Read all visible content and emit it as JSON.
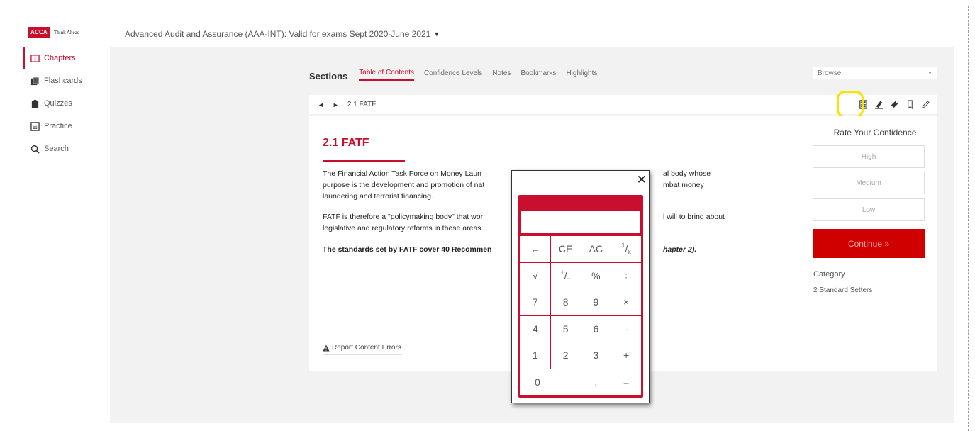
{
  "brand": {
    "logo_text": "ACCA",
    "tagline": "Think Ahead",
    "accent_color": "#c8102e"
  },
  "nav": {
    "items": [
      {
        "label": "Chapters",
        "icon": "book-icon",
        "active": true
      },
      {
        "label": "Flashcards",
        "icon": "flashcards-icon",
        "active": false
      },
      {
        "label": "Quizzes",
        "icon": "quiz-icon",
        "active": false
      },
      {
        "label": "Practice",
        "icon": "practice-icon",
        "active": false
      },
      {
        "label": "Search",
        "icon": "search-icon",
        "active": false
      }
    ]
  },
  "course": {
    "title": "Advanced Audit and Assurance (AAA-INT): Valid for exams Sept 2020-June 2021"
  },
  "sections": {
    "label": "Sections",
    "tabs": [
      {
        "label": "Table of Contents",
        "active": true
      },
      {
        "label": "Confidence Levels",
        "active": false
      },
      {
        "label": "Notes",
        "active": false
      },
      {
        "label": "Bookmarks",
        "active": false
      },
      {
        "label": "Highlights",
        "active": false
      }
    ],
    "browse": {
      "value": "Browse"
    }
  },
  "toolbar": {
    "prev": "◄",
    "next": "►",
    "breadcrumb": "2.1 FATF",
    "icons": [
      "calculator-icon",
      "highlighter-icon",
      "eraser-icon",
      "bookmark-icon",
      "pencil-icon"
    ]
  },
  "content": {
    "title": "2.1 FATF",
    "paragraphs": [
      "The Financial Action Task Force on Money Laun",
      "al body whose",
      "purpose is the development and promotion of nat",
      "mbat money",
      "laundering and terrorist financing.",
      "FATF is therefore a \"policymaking body\" that wor",
      "l will to bring about",
      "legislative and regulatory reforms in these areas.",
      "The standards set by FATF cover 40 Recommen",
      "hapter 2)."
    ],
    "report_link": "Report Content Errors"
  },
  "confidence": {
    "title": "Rate Your Confidence",
    "options": [
      "High",
      "Medium",
      "Low"
    ],
    "continue_label": "Continue »",
    "category_label": "Category",
    "category_value": "2 Standard Setters"
  },
  "calculator": {
    "close": "✕",
    "display": "",
    "keys": [
      "←",
      "CE",
      "AC",
      "1/x",
      "√",
      "+/-",
      "%",
      "÷",
      "7",
      "8",
      "9",
      "×",
      "4",
      "5",
      "6",
      "-",
      "1",
      "2",
      "3",
      "+",
      "0",
      ".",
      "="
    ]
  }
}
